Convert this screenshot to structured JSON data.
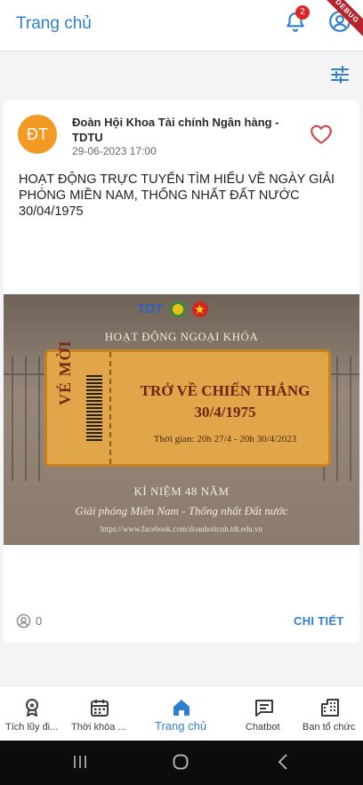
{
  "appbar": {
    "title": "Trang chủ",
    "notification_count": "2",
    "debug_ribbon": "DEBUG"
  },
  "post": {
    "avatar_initials": "ĐT",
    "author": "Đoàn Hội Khoa Tài chính Ngân hàng - TDTU",
    "date": "29-06-2023 17:00",
    "text": "HOẠT ĐỘNG TRỰC TUYẾN TÌM HIỂU VỀ NGÀY GIẢI PHÓNG MIỀN NAM, THỐNG NHẤT ĐẤT NƯỚC 30/04/1975",
    "like_count": "0",
    "detail_label": "CHI TIẾT",
    "poster": {
      "logos": "TDT",
      "heading": "HOẠT ĐỘNG NGOẠI KHÓA",
      "stub_label": "VÉ MỜI",
      "line1": "TRỞ VỀ CHIẾN THẮNG",
      "line2": "30/4/1975",
      "time": "Thời gian: 20h 27/4 - 20h 30/4/2023",
      "anniversary": "KỈ NIỆM 48 NĂM",
      "slogan": "Giải phóng Miền Nam - Thống nhất Đất nước",
      "url": "https://www.facebook.com/doanhoitcnh.tdt.edu.vn"
    }
  },
  "bottom_nav": {
    "items": [
      {
        "label": "Tích lũy đi...",
        "icon": "award-icon"
      },
      {
        "label": "Thời khóa ...",
        "icon": "calendar-icon"
      },
      {
        "label": "Trang chủ",
        "icon": "home-icon"
      },
      {
        "label": "Chatbot",
        "icon": "chat-icon"
      },
      {
        "label": "Ban tổ chức",
        "icon": "building-icon"
      }
    ]
  },
  "colors": {
    "accent": "#2f7fd0",
    "avatar": "#f29a24",
    "heart": "#d14a52",
    "badge": "#d9262b"
  }
}
